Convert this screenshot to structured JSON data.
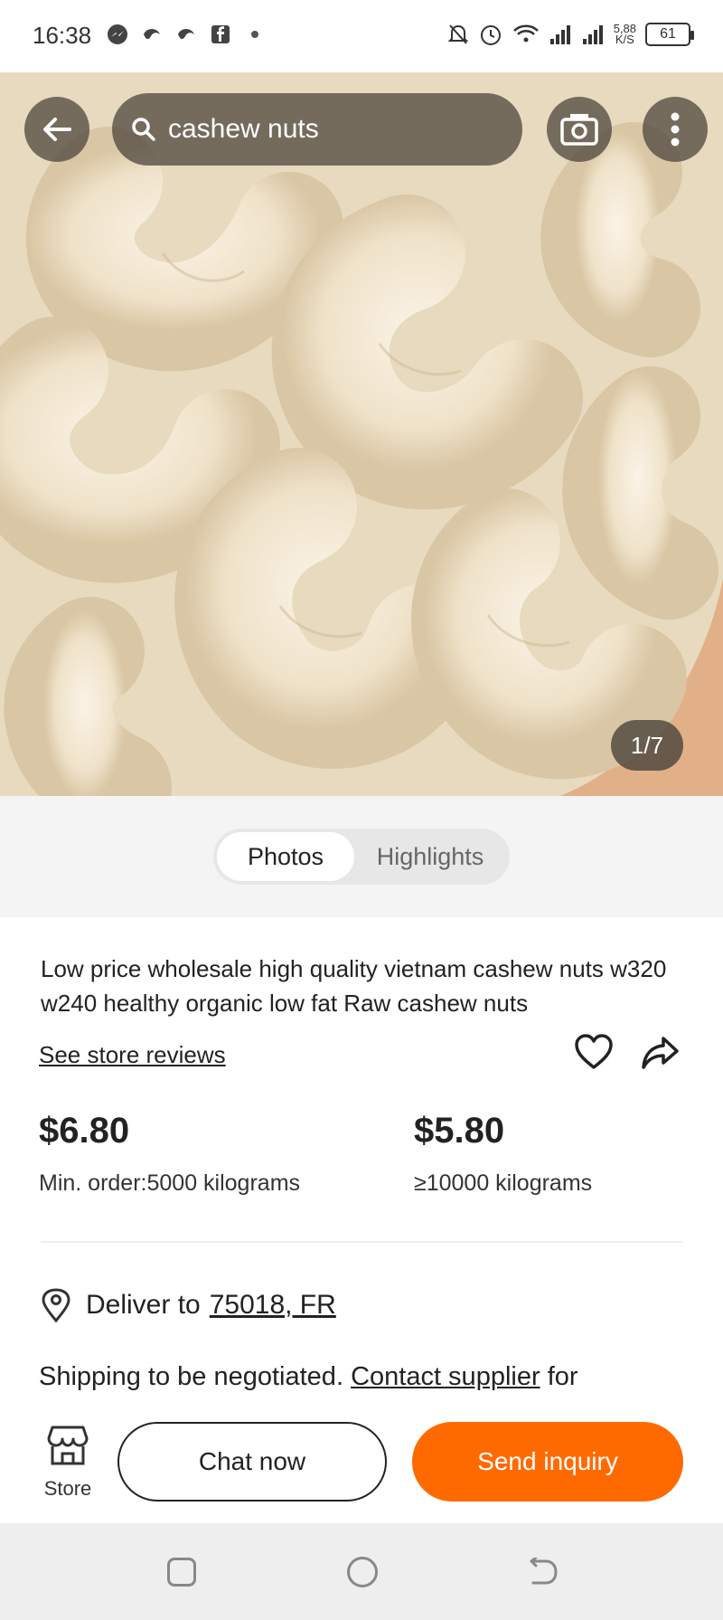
{
  "status_bar": {
    "time": "16:38",
    "net_speed_value": "5,88",
    "net_speed_unit": "K/S",
    "battery": "61",
    "left_icons": [
      "messenger-icon",
      "bird-icon",
      "bird-icon",
      "facebook-icon",
      "dot-icon"
    ],
    "right_icons": [
      "mute-icon",
      "alarm-icon",
      "wifi-icon",
      "signal-icon",
      "signal-icon"
    ]
  },
  "header": {
    "search_query": "cashew nuts",
    "back_icon": "back-arrow-icon",
    "camera_icon": "camera-icon",
    "more_icon": "more-vertical-icon"
  },
  "gallery": {
    "counter": "1/7"
  },
  "tabs": [
    {
      "label": "Photos",
      "active": true
    },
    {
      "label": "Highlights",
      "active": false
    }
  ],
  "product": {
    "title": "Low price wholesale high quality vietnam cashew nuts w320 w240 healthy organic low fat Raw cashew nuts",
    "reviews_link": "See store reviews",
    "prices": [
      {
        "price": "$6.80",
        "quantity": "Min. order:5000 kilograms"
      },
      {
        "price": "$5.80",
        "quantity": "≥10000 kilograms"
      }
    ]
  },
  "delivery": {
    "label": "Deliver to",
    "location": "75018, FR"
  },
  "shipping": {
    "text": "Shipping to be negotiated.",
    "link": "Contact supplier",
    "suffix": "for"
  },
  "actions": {
    "store_label": "Store",
    "chat_label": "Chat now",
    "inquiry_label": "Send inquiry"
  },
  "colors": {
    "accent": "#ff6a00",
    "overlay": "#464038"
  }
}
